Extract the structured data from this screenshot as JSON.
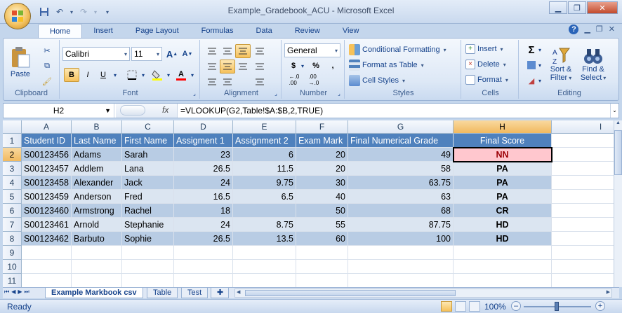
{
  "window": {
    "title": "Example_Gradebook_ACU - Microsoft Excel"
  },
  "tabs": [
    "Home",
    "Insert",
    "Page Layout",
    "Formulas",
    "Data",
    "Review",
    "View"
  ],
  "ribbon": {
    "clipboard": {
      "label": "Clipboard",
      "paste": "Paste"
    },
    "font": {
      "label": "Font",
      "name": "Calibri",
      "size": "11",
      "bold": "B",
      "italic": "I",
      "underline": "U",
      "grow": "A",
      "shrink": "A"
    },
    "alignment": {
      "label": "Alignment"
    },
    "number": {
      "label": "Number",
      "format": "General",
      "currency": "$",
      "percent": "%",
      "comma": ","
    },
    "styles": {
      "label": "Styles",
      "conditional": "Conditional Formatting",
      "format_table": "Format as Table",
      "cell_styles": "Cell Styles"
    },
    "cells": {
      "label": "Cells",
      "insert": "Insert",
      "delete": "Delete",
      "format": "Format"
    },
    "editing": {
      "label": "Editing",
      "sort": "Sort &",
      "filter": "Filter",
      "find": "Find &",
      "select": "Select"
    }
  },
  "formula_bar": {
    "name_box": "H2",
    "fx": "fx",
    "formula": "=VLOOKUP(G2,Table!$A:$B,2,TRUE)"
  },
  "columns": [
    "A",
    "B",
    "C",
    "D",
    "E",
    "F",
    "G",
    "H",
    "I"
  ],
  "rows": [
    "1",
    "2",
    "3",
    "4",
    "5",
    "6",
    "7",
    "8",
    "9",
    "10",
    "11"
  ],
  "sheet": {
    "header": [
      "Student ID",
      "Last Name",
      "First Name",
      "Assigment 1",
      "Assignment 2",
      "Exam Mark",
      "Final Numerical Grade",
      "Final Score"
    ],
    "data": [
      [
        "S00123456",
        "Adams",
        "Sarah",
        "23",
        "6",
        "20",
        "49",
        "NN"
      ],
      [
        "S00123457",
        "Addlem",
        "Lana",
        "26.5",
        "11.5",
        "20",
        "58",
        "PA"
      ],
      [
        "S00123458",
        "Alexander",
        "Jack",
        "24",
        "9.75",
        "30",
        "63.75",
        "PA"
      ],
      [
        "S00123459",
        "Anderson",
        "Fred",
        "16.5",
        "6.5",
        "40",
        "63",
        "PA"
      ],
      [
        "S00123460",
        "Armstrong",
        "Rachel",
        "18",
        "",
        "50",
        "68",
        "CR"
      ],
      [
        "S00123461",
        "Arnold",
        "Stephanie",
        "24",
        "8.75",
        "55",
        "87.75",
        "HD"
      ],
      [
        "S00123462",
        "Barbuto",
        "Sophie",
        "26.5",
        "13.5",
        "60",
        "100",
        "HD"
      ]
    ]
  },
  "sheet_tabs": [
    "Example Markbook csv",
    "Table",
    "Test"
  ],
  "status": {
    "ready": "Ready",
    "zoom": "100%",
    "minus": "–",
    "plus": "+"
  },
  "colors": {
    "header_fill": "#4f81bd",
    "band_dark": "#b8cce4",
    "band_light": "#dbe5f1",
    "nn_fill": "#ffc7ce",
    "nn_text": "#9c0006"
  }
}
